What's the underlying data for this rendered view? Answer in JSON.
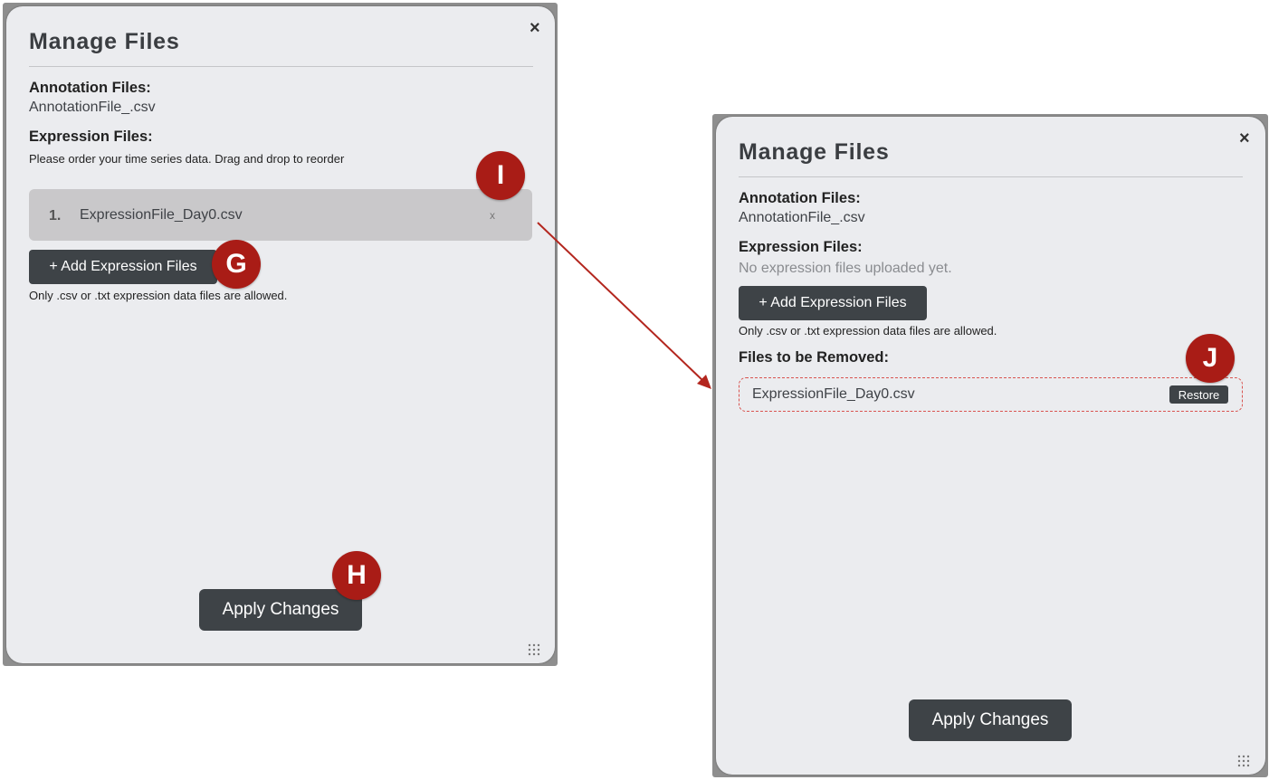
{
  "left_dialog": {
    "title": "Manage Files",
    "close_glyph": "×",
    "annotation_label": "Annotation Files:",
    "annotation_file": "AnnotationFile_.csv",
    "expression_label": "Expression Files:",
    "expression_hint": "Please order your time series data. Drag and drop to reorder",
    "expression_files": [
      {
        "index": "1.",
        "name": "ExpressionFile_Day0.csv",
        "remove_glyph": "x"
      }
    ],
    "add_button_label": "+ Add Expression Files",
    "allowed_hint": "Only .csv or .txt expression data files are allowed.",
    "apply_button_label": "Apply Changes"
  },
  "right_dialog": {
    "title": "Manage Files",
    "close_glyph": "×",
    "annotation_label": "Annotation Files:",
    "annotation_file": "AnnotationFile_.csv",
    "expression_label": "Expression Files:",
    "no_files_text": "No expression files uploaded yet.",
    "add_button_label": "+ Add Expression Files",
    "allowed_hint": "Only .csv or .txt expression data files are allowed.",
    "removed_label": "Files to be Removed:",
    "removed_files": [
      {
        "name": "ExpressionFile_Day0.csv",
        "restore_label": "Restore"
      }
    ],
    "apply_button_label": "Apply Changes"
  },
  "markers": {
    "g": "G",
    "h": "H",
    "i": "I",
    "j": "J"
  },
  "icons": {
    "close": "close-icon",
    "remove": "remove-x-icon",
    "resize": "resize-grip-icon",
    "arrow": "arrow-icon"
  },
  "colors": {
    "marker": "#a91c16",
    "button": "#3e4347",
    "dialog_bg": "#ebecef",
    "dashed_border": "#d9534f"
  }
}
